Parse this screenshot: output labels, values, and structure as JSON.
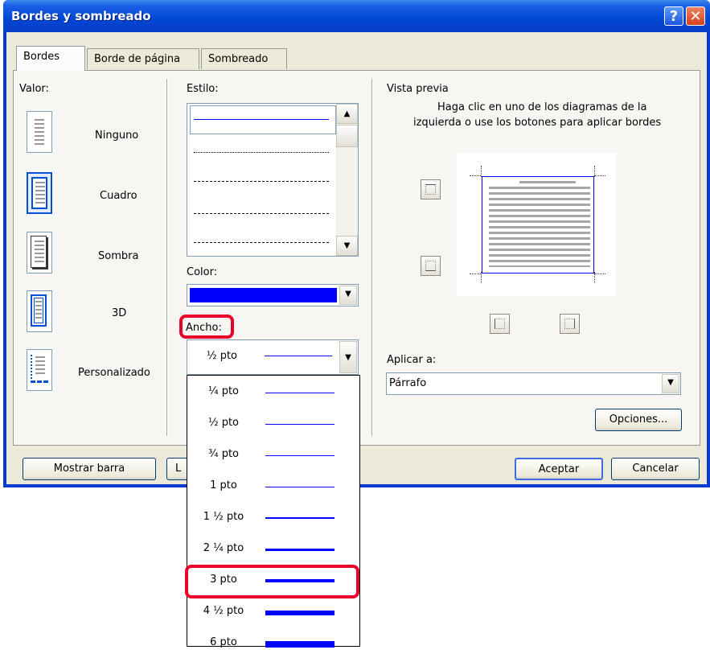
{
  "window": {
    "title": "Bordes y sombreado"
  },
  "tabs": [
    {
      "label": "Bordes"
    },
    {
      "label": "Borde de página"
    },
    {
      "label": "Sombreado"
    }
  ],
  "setting": {
    "label": "Valor:",
    "items": [
      {
        "label": "Ninguno"
      },
      {
        "label": "Cuadro"
      },
      {
        "label": "Sombra"
      },
      {
        "label": "3D"
      },
      {
        "label": "Personalizado"
      }
    ],
    "selected": "Cuadro"
  },
  "style": {
    "label": "Estilo:"
  },
  "color": {
    "label": "Color:",
    "value": "#0000ff"
  },
  "width": {
    "label": "Ancho:",
    "value": "½ pto",
    "options": [
      "¼ pto",
      "½ pto",
      "¾ pto",
      "1 pto",
      "1 ½ pto",
      "2 ¼ pto",
      "3 pto",
      "4 ½ pto",
      "6 pto"
    ],
    "highlighted": "3 pto"
  },
  "preview": {
    "label": "Vista previa",
    "hint_line1": "Haga clic en uno de los diagramas de la",
    "hint_line2": "izquierda o use los botones para aplicar bordes"
  },
  "apply_to": {
    "label": "Aplicar a:",
    "value": "Párrafo"
  },
  "buttons": {
    "options": "Opciones...",
    "show_toolbar": "Mostrar barra",
    "partial_left": "L",
    "ok": "Aceptar",
    "cancel": "Cancelar"
  },
  "colors": {
    "accent_blue": "#0000ff",
    "highlight_red": "#e8002a",
    "title_blue": "#0047d6"
  }
}
